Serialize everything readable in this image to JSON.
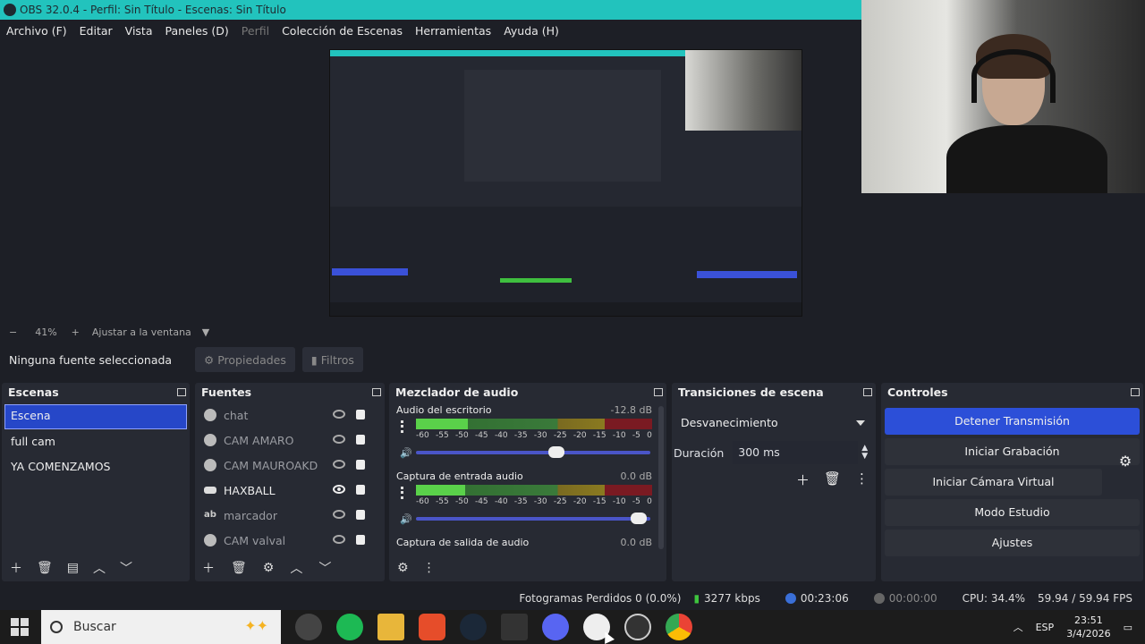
{
  "window": {
    "title": "OBS 32.0.4 - Perfil: Sin Título - Escenas: Sin Título"
  },
  "menu": [
    {
      "label": "Archivo (F)",
      "enabled": true
    },
    {
      "label": "Editar",
      "enabled": true
    },
    {
      "label": "Vista",
      "enabled": true
    },
    {
      "label": "Paneles (D)",
      "enabled": true
    },
    {
      "label": "Perfil",
      "enabled": false
    },
    {
      "label": "Colección de Escenas",
      "enabled": true
    },
    {
      "label": "Herramientas",
      "enabled": true
    },
    {
      "label": "Ayuda (H)",
      "enabled": true
    }
  ],
  "zoom": {
    "minus": "−",
    "value": "41%",
    "plus": "+",
    "fit_label": "Ajustar a la ventana"
  },
  "source_bar": {
    "no_source": "Ninguna fuente seleccionada",
    "properties": "Propiedades",
    "filters": "Filtros"
  },
  "scenes": {
    "title": "Escenas",
    "items": [
      "Escena",
      "full cam",
      "YA COMENZAMOS"
    ],
    "selected": "Escena"
  },
  "sources": {
    "title": "Fuentes",
    "items": [
      {
        "name": "chat",
        "icon": "globe-icon",
        "visible": false
      },
      {
        "name": "CAM AMARO",
        "icon": "globe-icon",
        "visible": false
      },
      {
        "name": "CAM MAUROAKD",
        "icon": "globe-icon",
        "visible": false
      },
      {
        "name": "HAXBALL",
        "icon": "gamepad-icon",
        "visible": true
      },
      {
        "name": "marcador",
        "icon": "text-icon",
        "visible": false
      },
      {
        "name": "CAM valval",
        "icon": "globe-icon",
        "visible": false
      }
    ]
  },
  "mixer": {
    "title": "Mezclador de audio",
    "channels": [
      {
        "name": "Audio del escritorio",
        "db": "-12.8 dB",
        "level": 0.22,
        "volume": 0.6
      },
      {
        "name": "Captura de entrada audio",
        "db": "0.0 dB",
        "level": 0.21,
        "volume": 0.95
      },
      {
        "name": "Captura de salida de audio",
        "db": "0.0 dB"
      }
    ],
    "ticks": [
      "-60",
      "-55",
      "-50",
      "-45",
      "-40",
      "-35",
      "-30",
      "-25",
      "-20",
      "-15",
      "-10",
      "-5",
      "0"
    ]
  },
  "transitions": {
    "title": "Transiciones de escena",
    "selected": "Desvanecimiento",
    "duration_label": "Duración",
    "duration_value": "300 ms"
  },
  "controls": {
    "title": "Controles",
    "buttons": [
      "Detener Transmisión",
      "Iniciar Grabación",
      "Iniciar Cámara Virtual",
      "Modo Estudio",
      "Ajustes"
    ]
  },
  "status": {
    "dropped": "Fotogramas Perdidos 0 (0.0%)",
    "bitrate": "3277 kbps",
    "stream_time": "00:23:06",
    "rec_time": "00:00:00",
    "cpu": "CPU: 34.4%",
    "fps": "59.94 / 59.94 FPS"
  },
  "taskbar": {
    "search_placeholder": "Buscar",
    "lang": "ESP",
    "time": "23:51",
    "date": "3/4/2026"
  }
}
